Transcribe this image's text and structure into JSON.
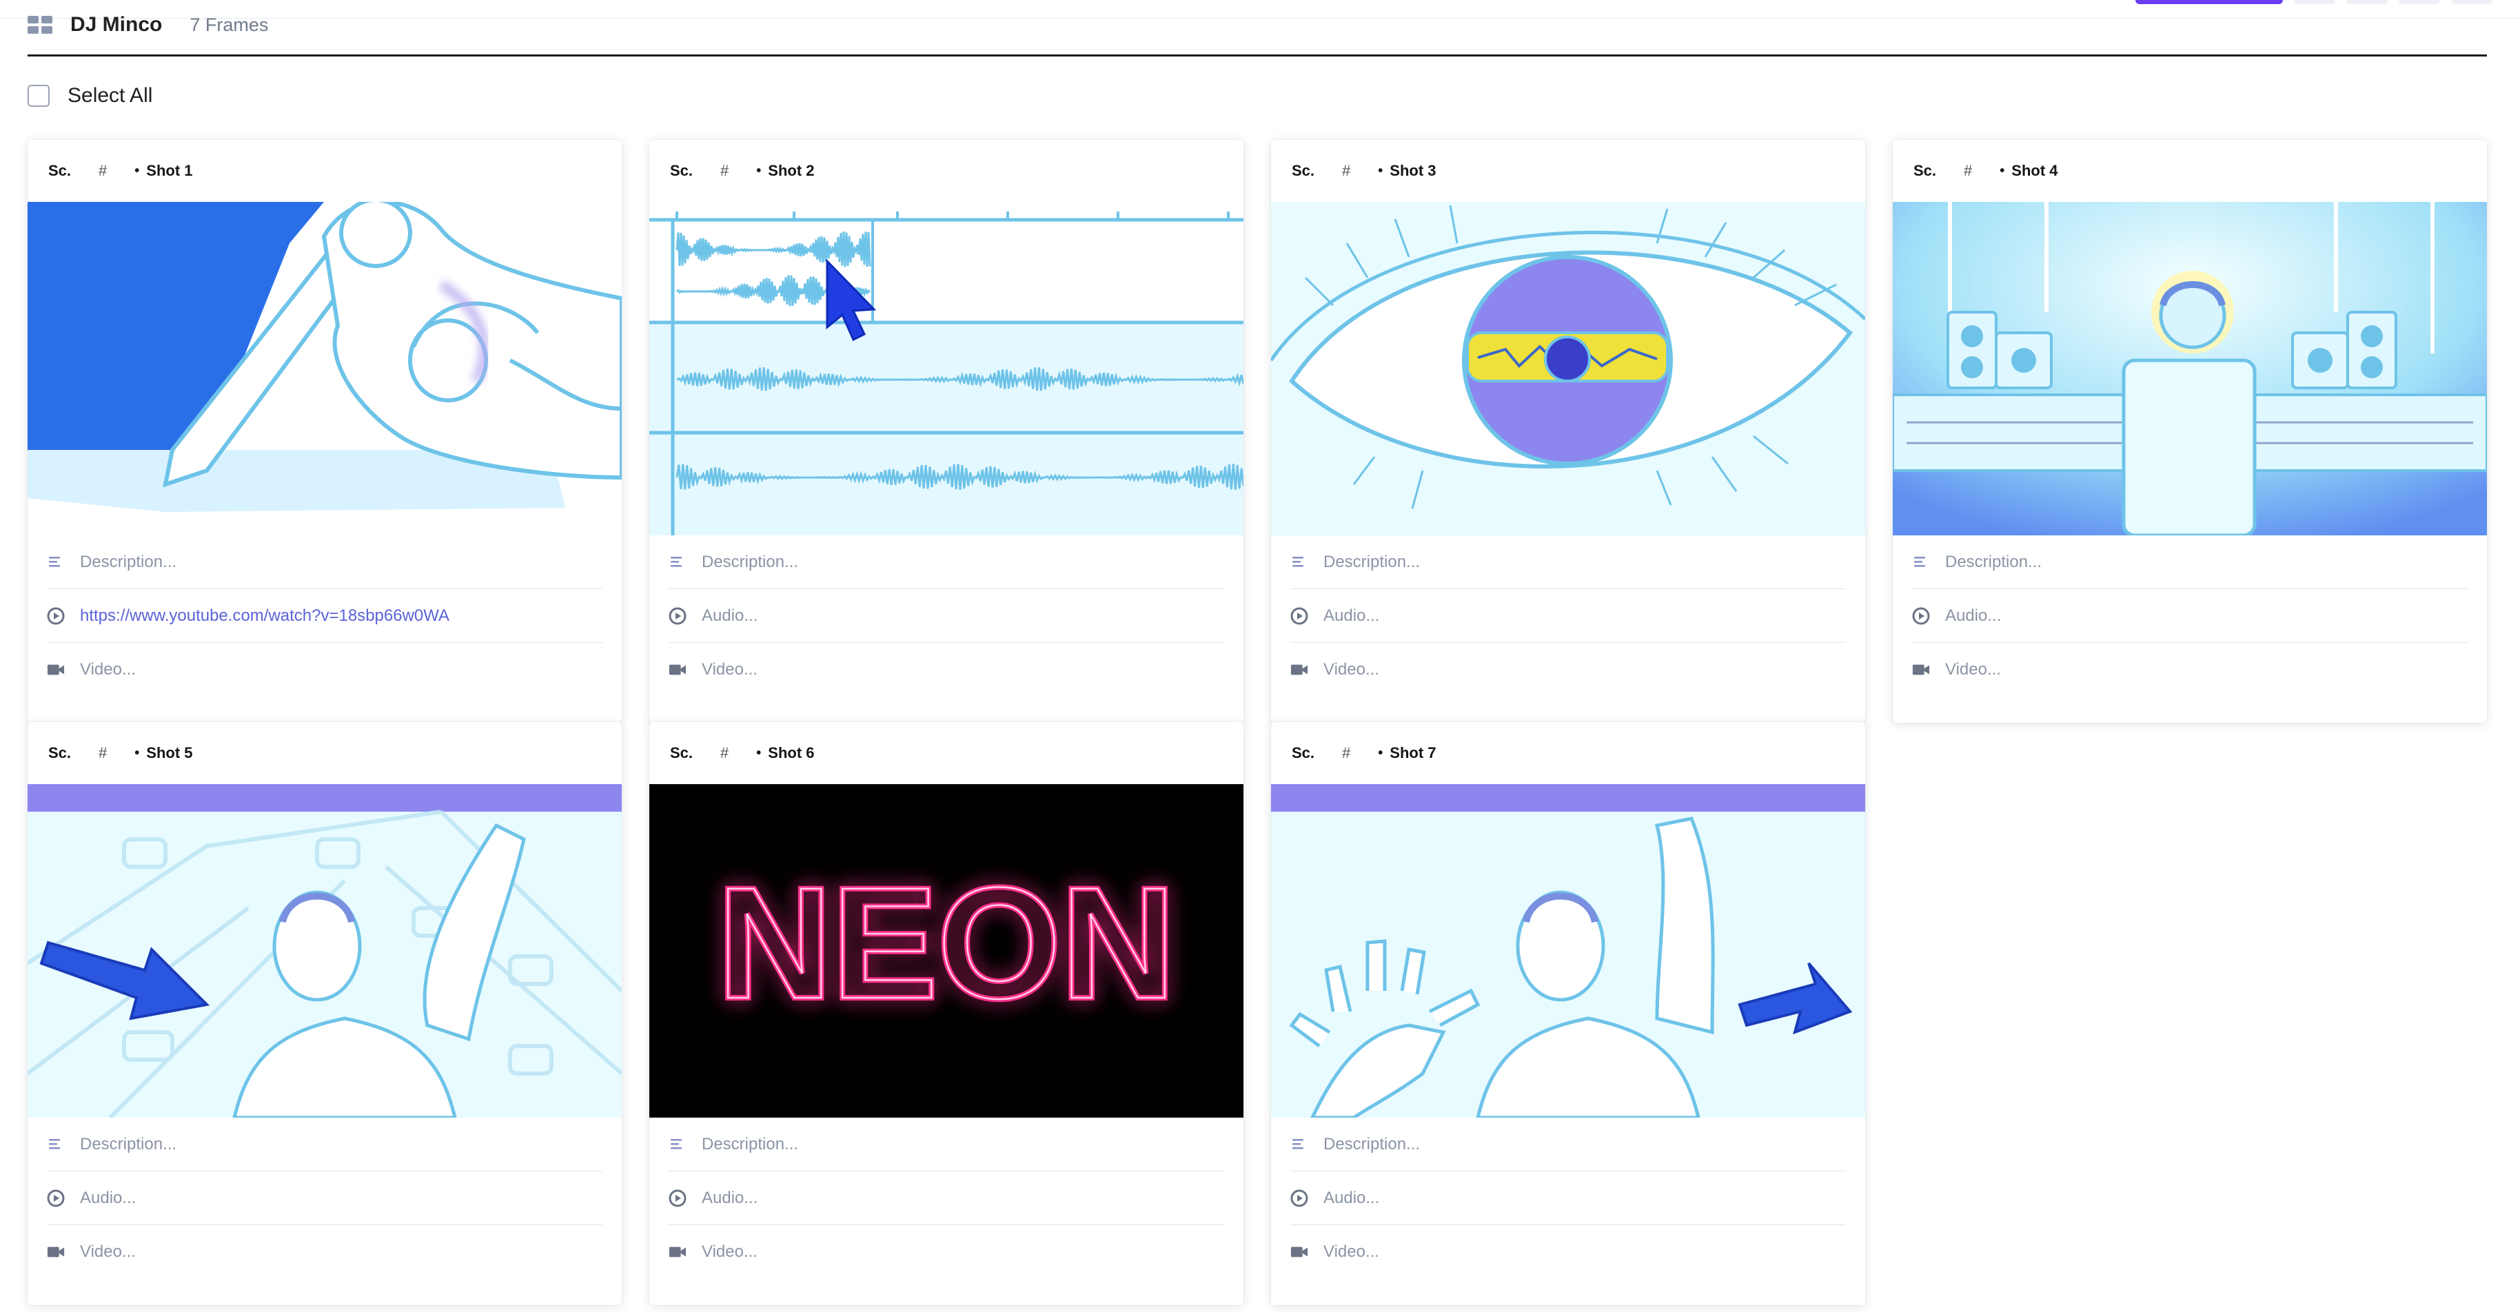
{
  "header": {
    "project_title": "DJ Minco",
    "frame_count": "7 Frames",
    "select_all": "Select All"
  },
  "colors": {
    "accent": "#6a3df0",
    "sketch_blue": "#6ec3e8",
    "sky": "#e8fbff",
    "violet": "#8d86ee",
    "deep_blue": "#1f3de0",
    "neon_pink": "#ff2e8a"
  },
  "cards": [
    {
      "sc": "Sc.",
      "hash": "#",
      "bullet": "•",
      "shot": "Shot 1",
      "description": "Description...",
      "audio": "https://www.youtube.com/watch?v=18sbp66w0WA",
      "video": "Video...",
      "scene": "hand-drawing"
    },
    {
      "sc": "Sc.",
      "hash": "#",
      "bullet": "•",
      "shot": "Shot 2",
      "description": "Description...",
      "audio": "Audio...",
      "video": "Video...",
      "scene": "waveforms"
    },
    {
      "sc": "Sc.",
      "hash": "#",
      "bullet": "•",
      "shot": "Shot 3",
      "description": "Description...",
      "audio": "Audio...",
      "video": "Video...",
      "scene": "eye"
    },
    {
      "sc": "Sc.",
      "hash": "#",
      "bullet": "•",
      "shot": "Shot 4",
      "description": "Description...",
      "audio": "Audio...",
      "video": "Video...",
      "scene": "studio"
    },
    {
      "sc": "Sc.",
      "hash": "#",
      "bullet": "•",
      "shot": "Shot 5",
      "description": "Description...",
      "audio": "Audio...",
      "video": "Video...",
      "scene": "figure-arrow-left"
    },
    {
      "sc": "Sc.",
      "hash": "#",
      "bullet": "•",
      "shot": "Shot 6",
      "description": "Description...",
      "audio": "Audio...",
      "video": "Video...",
      "scene": "neon",
      "neon_text": "NEON"
    },
    {
      "sc": "Sc.",
      "hash": "#",
      "bullet": "•",
      "shot": "Shot 7",
      "description": "Description...",
      "audio": "Audio...",
      "video": "Video...",
      "scene": "figure-hand-arrow-right"
    }
  ],
  "icons": {
    "description": "text-lines-icon",
    "audio": "play-circle-icon",
    "video": "video-camera-icon",
    "header": "grid-view-icon"
  }
}
